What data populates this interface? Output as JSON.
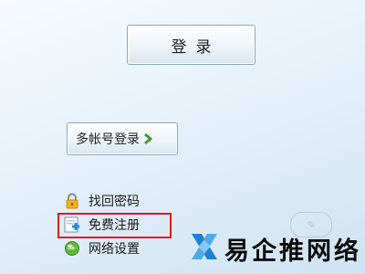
{
  "login_button": {
    "label": "登录"
  },
  "multi_account_button": {
    "label": "多帐号登录"
  },
  "links": [
    {
      "label": "找回密码",
      "icon": "lock-icon"
    },
    {
      "label": "免费注册",
      "icon": "add-user-icon",
      "highlighted": true
    },
    {
      "label": "网络设置",
      "icon": "globe-icon"
    }
  ],
  "brand": {
    "text": "易企推网络",
    "icon": "x-logo-icon"
  },
  "colors": {
    "highlight": "#e8141b",
    "chevron": "#3e9a2a",
    "brand_blue": "#1e82d2"
  }
}
